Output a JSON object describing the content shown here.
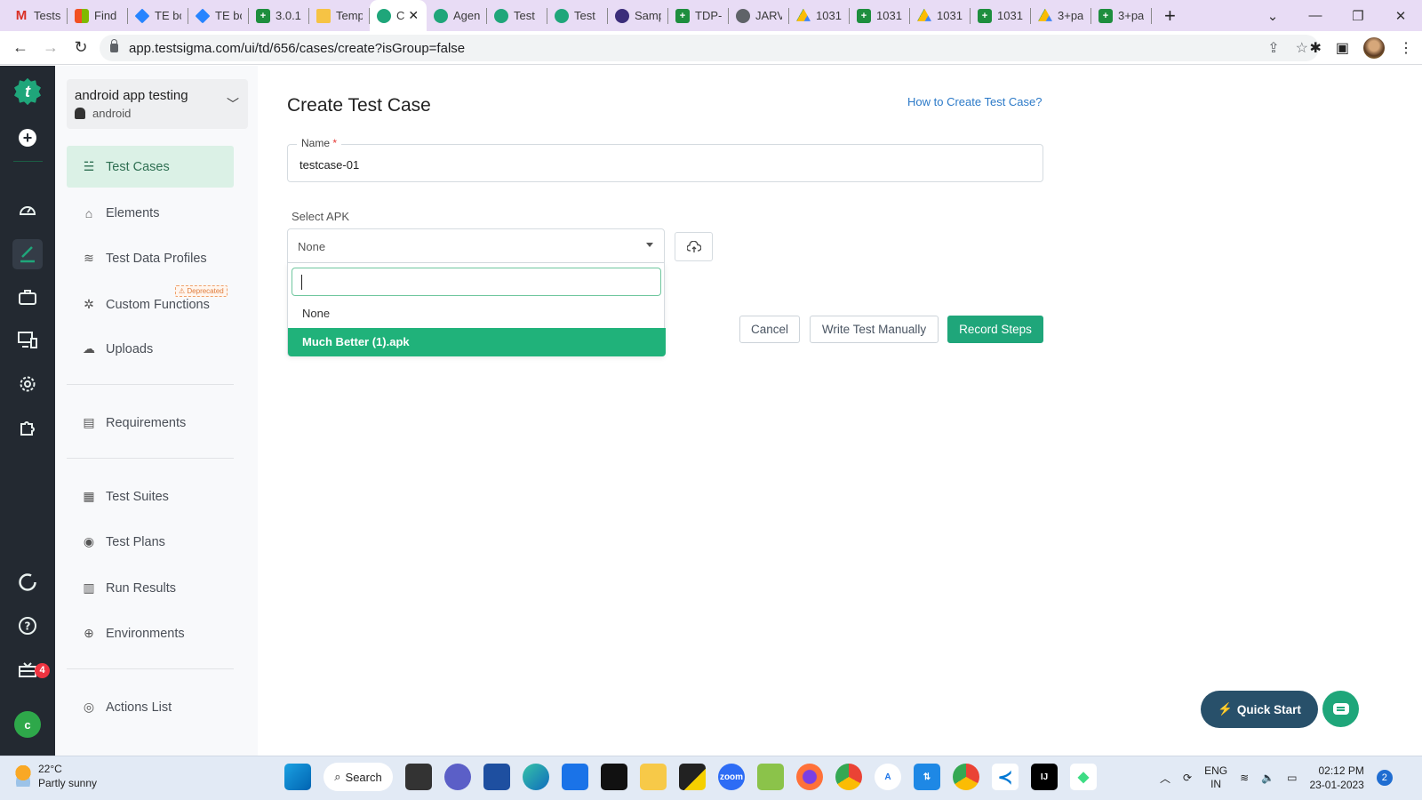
{
  "browser": {
    "tabs": [
      {
        "icon": "gmail-icon",
        "title": "Tests"
      },
      {
        "icon": "microsoft-icon",
        "title": "Find"
      },
      {
        "icon": "jira-icon",
        "title": "TE bc"
      },
      {
        "icon": "jira-icon",
        "title": "TE bc"
      },
      {
        "icon": "sheets-icon",
        "title": "3.0.1"
      },
      {
        "icon": "mail-icon",
        "title": "Temp"
      },
      {
        "icon": "testsigma-icon",
        "title": "C",
        "active": true
      },
      {
        "icon": "testsigma-icon",
        "title": "Agen"
      },
      {
        "icon": "testsigma-icon",
        "title": "Test"
      },
      {
        "icon": "testsigma-icon",
        "title": "Test"
      },
      {
        "icon": "app-icon",
        "title": "Samp"
      },
      {
        "icon": "sheets-icon",
        "title": "TDP-"
      },
      {
        "icon": "globe-icon",
        "title": "JARV"
      },
      {
        "icon": "drive-icon",
        "title": "1031"
      },
      {
        "icon": "sheets-icon",
        "title": "1031"
      },
      {
        "icon": "drive-icon",
        "title": "1031"
      },
      {
        "icon": "sheets-icon",
        "title": "1031"
      },
      {
        "icon": "drive-icon",
        "title": "3+pa"
      },
      {
        "icon": "sheets-icon",
        "title": "3+pa"
      }
    ],
    "new_tab": "+",
    "url": "app.testsigma.com/ui/td/656/cases/create?isGroup=false"
  },
  "rail": {
    "logo": "t",
    "badge_count": "4",
    "avatar_initial": "c"
  },
  "sidebar": {
    "project_name": "android app testing",
    "project_platform": "android",
    "deprecated_label": "⚠ Deprecated",
    "items": [
      {
        "label": "Test Cases",
        "icon": "☱"
      },
      {
        "label": "Elements",
        "icon": "⌂"
      },
      {
        "label": "Test Data Profiles",
        "icon": "≋"
      },
      {
        "label": "Custom Functions",
        "icon": "✲"
      },
      {
        "label": "Uploads",
        "icon": "☁"
      },
      {
        "label": "Requirements",
        "icon": "▤"
      },
      {
        "label": "Test Suites",
        "icon": "▦"
      },
      {
        "label": "Test Plans",
        "icon": "◉"
      },
      {
        "label": "Run Results",
        "icon": "▥"
      },
      {
        "label": "Environments",
        "icon": "⊕"
      },
      {
        "label": "Actions List",
        "icon": "◎"
      }
    ]
  },
  "main": {
    "title": "Create Test Case",
    "help_link": "How to Create Test Case?",
    "name_label": "Name",
    "name_required": "*",
    "name_value": "testcase-01",
    "apk_label": "Select APK",
    "apk_selected": "None",
    "apk_search_value": "",
    "apk_options": [
      "None",
      "Much Better (1).apk"
    ],
    "apk_highlighted": "Much Better (1).apk",
    "buttons": {
      "cancel": "Cancel",
      "write_manually": "Write Test Manually",
      "record_steps": "Record Steps"
    },
    "quick_start": "Quick Start"
  },
  "taskbar": {
    "temperature": "22°C",
    "weather": "Partly sunny",
    "search": "Search",
    "lang_line1": "ENG",
    "lang_line2": "IN",
    "time": "02:12 PM",
    "date": "23-01-2023",
    "notifications": "2"
  }
}
